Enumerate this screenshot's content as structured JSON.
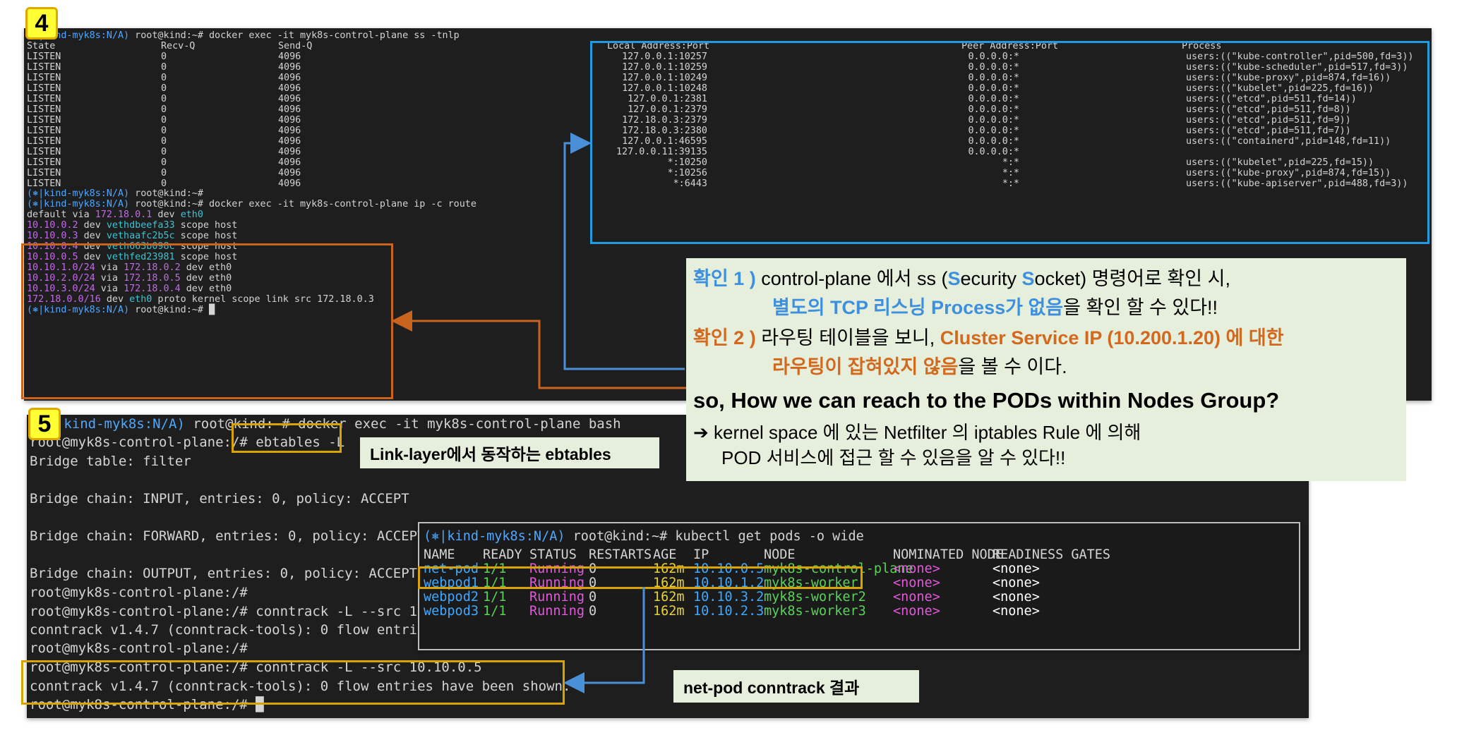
{
  "steps": {
    "step4": "4",
    "step5": "5"
  },
  "term4": {
    "prompt_env": "(⎈|kind-myk8s:N/A)",
    "prompt_user": " root@kind:~# ",
    "cmd_ss": "docker exec -it myk8s-control-plane ss -tnlp",
    "headers": [
      "State",
      "Recv-Q",
      "Send-Q",
      "Local Address:Port",
      "Peer Address:Port",
      "Process"
    ],
    "ss_rows": [
      {
        "state": "LISTEN",
        "recv": "0",
        "send": "4096",
        "local": "127.0.0.1:10257",
        "peer": "0.0.0.0:*",
        "proc": "users:((\"kube-controller\",pid=500,fd=3))"
      },
      {
        "state": "LISTEN",
        "recv": "0",
        "send": "4096",
        "local": "127.0.0.1:10259",
        "peer": "0.0.0.0:*",
        "proc": "users:((\"kube-scheduler\",pid=517,fd=3))"
      },
      {
        "state": "LISTEN",
        "recv": "0",
        "send": "4096",
        "local": "127.0.0.1:10249",
        "peer": "0.0.0.0:*",
        "proc": "users:((\"kube-proxy\",pid=874,fd=16))"
      },
      {
        "state": "LISTEN",
        "recv": "0",
        "send": "4096",
        "local": "127.0.0.1:10248",
        "peer": "0.0.0.0:*",
        "proc": "users:((\"kubelet\",pid=225,fd=16))"
      },
      {
        "state": "LISTEN",
        "recv": "0",
        "send": "4096",
        "local": "127.0.0.1:2381",
        "peer": "0.0.0.0:*",
        "proc": "users:((\"etcd\",pid=511,fd=14))"
      },
      {
        "state": "LISTEN",
        "recv": "0",
        "send": "4096",
        "local": "127.0.0.1:2379",
        "peer": "0.0.0.0:*",
        "proc": "users:((\"etcd\",pid=511,fd=8))"
      },
      {
        "state": "LISTEN",
        "recv": "0",
        "send": "4096",
        "local": "172.18.0.3:2379",
        "peer": "0.0.0.0:*",
        "proc": "users:((\"etcd\",pid=511,fd=9))"
      },
      {
        "state": "LISTEN",
        "recv": "0",
        "send": "4096",
        "local": "172.18.0.3:2380",
        "peer": "0.0.0.0:*",
        "proc": "users:((\"etcd\",pid=511,fd=7))"
      },
      {
        "state": "LISTEN",
        "recv": "0",
        "send": "4096",
        "local": "127.0.0.1:46595",
        "peer": "0.0.0.0:*",
        "proc": "users:((\"containerd\",pid=148,fd=11))"
      },
      {
        "state": "LISTEN",
        "recv": "0",
        "send": "4096",
        "local": "127.0.0.11:39135",
        "peer": "0.0.0.0:*",
        "proc": ""
      },
      {
        "state": "LISTEN",
        "recv": "0",
        "send": "4096",
        "local": "*:10250",
        "peer": "*:*",
        "proc": "users:((\"kubelet\",pid=225,fd=15))"
      },
      {
        "state": "LISTEN",
        "recv": "0",
        "send": "4096",
        "local": "*:10256",
        "peer": "*:*",
        "proc": "users:((\"kube-proxy\",pid=874,fd=15))"
      },
      {
        "state": "LISTEN",
        "recv": "0",
        "send": "4096",
        "local": "*:6443",
        "peer": "*:*",
        "proc": "users:((\"kube-apiserver\",pid=488,fd=3))"
      }
    ],
    "cmd_route": "docker exec -it myk8s-control-plane ip -c route",
    "route_rows": [
      {
        "a": "default via ",
        "b": "172.18.0.1",
        "c": " dev ",
        "d": "eth0",
        "e": ""
      },
      {
        "a": "",
        "b": "10.10.0.2",
        "c": " dev ",
        "d": "vethdbeefa33",
        "e": " scope host"
      },
      {
        "a": "",
        "b": "10.10.0.3",
        "c": " dev ",
        "d": "vethaafc2b5c",
        "e": " scope host"
      },
      {
        "a": "",
        "b": "10.10.0.4",
        "c": " dev ",
        "d": "veth663b098c",
        "e": " scope host"
      },
      {
        "a": "",
        "b": "10.10.0.5",
        "c": " dev ",
        "d": "vethfed23981",
        "e": " scope host"
      },
      {
        "a": "",
        "b": "10.10.1.0/24",
        "c": " via ",
        "d": "172.18.0.2",
        "e": " dev eth0"
      },
      {
        "a": "",
        "b": "10.10.2.0/24",
        "c": " via ",
        "d": "172.18.0.5",
        "e": " dev eth0"
      },
      {
        "a": "",
        "b": "10.10.3.0/24",
        "c": " via ",
        "d": "172.18.0.4",
        "e": " dev eth0"
      },
      {
        "a": "",
        "b": "172.18.0.0/16",
        "c": " dev ",
        "d": "eth0",
        "e": " proto kernel scope link src 172.18.0.3"
      }
    ]
  },
  "term5": {
    "prompt_env": "(⎈|kind-myk8s:N/A)",
    "prompt_user": " root@kind:~# ",
    "cmd_bash": "docker exec -it myk8s-control-plane bash",
    "root_prompt": "root@myk8s-control-plane:/# ",
    "root_prompt_bare": "root@myk8s-control-plane:/#",
    "cmd_ebtables": "ebtables -L",
    "bridge_table": "Bridge table: filter",
    "chain_input": "Bridge chain: INPUT, entries: 0, policy: ACCEPT",
    "chain_forward": "Bridge chain: FORWARD, entries: 0, policy: ACCEPT",
    "chain_output": "Bridge chain: OUTPUT, entries: 0, policy: ACCEPT",
    "cmd_conntrack_partial": "conntrack -L --src 10",
    "conntrack_partial": "conntrack v1.4.7 (conntrack-tools): 0 flow entrie",
    "cmd_conntrack": "conntrack -L --src 10.10.0.5",
    "conntrack_result": "conntrack v1.4.7 (conntrack-tools): 0 flow entries have been shown."
  },
  "pods": {
    "prompt_env": "(⎈|kind-myk8s:N/A)",
    "prompt_user": " root@kind:~# ",
    "cmd": "kubectl get pods -o wide",
    "headers": [
      "NAME",
      "READY",
      "STATUS",
      "RESTARTS",
      "AGE",
      "IP",
      "NODE",
      "NOMINATED NODE",
      "READINESS GATES"
    ],
    "rows": [
      {
        "name": "net-pod",
        "ready": "1/1",
        "status": "Running",
        "restarts": "0",
        "age": "162m",
        "ip": "10.10.0.5",
        "node": "myk8s-control-plane",
        "nominated": "<none>",
        "gates": "<none>"
      },
      {
        "name": "webpod1",
        "ready": "1/1",
        "status": "Running",
        "restarts": "0",
        "age": "162m",
        "ip": "10.10.1.2",
        "node": "myk8s-worker",
        "nominated": "<none>",
        "gates": "<none>"
      },
      {
        "name": "webpod2",
        "ready": "1/1",
        "status": "Running",
        "restarts": "0",
        "age": "162m",
        "ip": "10.10.3.2",
        "node": "myk8s-worker2",
        "nominated": "<none>",
        "gates": "<none>"
      },
      {
        "name": "webpod3",
        "ready": "1/1",
        "status": "Running",
        "restarts": "0",
        "age": "162m",
        "ip": "10.10.2.3",
        "node": "myk8s-worker3",
        "nominated": "<none>",
        "gates": "<none>"
      }
    ]
  },
  "labels": {
    "ebtables": "Link-layer에서 동작하는 ebtables",
    "conntrack": "net-pod conntrack 결과"
  },
  "note": {
    "c1_tag": "확인 1 )",
    "c1_a": " control-plane 에서 ss (",
    "c1_s1": "S",
    "c1_b": "ecurity ",
    "c1_s2": "S",
    "c1_c": "ocket) 명령어로 확인 시,",
    "c1_line2_hl": "별도의 TCP 리스닝 Process가 없음",
    "c1_line2_rest": "을 확인 할 수 있다!!",
    "c2_tag": "확인 2 )",
    "c2_a": " 라우팅 테이블을 보니, ",
    "c2_hl": "Cluster Service IP (10.200.1.20) 에 대한",
    "c2_line2_hl": "라우팅이 잡혀있지 않음",
    "c2_line2_rest": "을 볼 수 이다.",
    "question": "so, How we can reach to the PODs within Nodes Group?",
    "arrow": "➔",
    "answer1": " kernel space 에 있는 Netfilter 의 iptables Rule 에 의해",
    "answer2": "POD 서비스에 접근 할 수 있음을 알 수 있다!!"
  },
  "colors": {
    "blue_frame": "#1f9be0",
    "orange_frame": "#c8641e",
    "yellow_frame": "#d9a400",
    "note_bg": "#e6efdc"
  }
}
